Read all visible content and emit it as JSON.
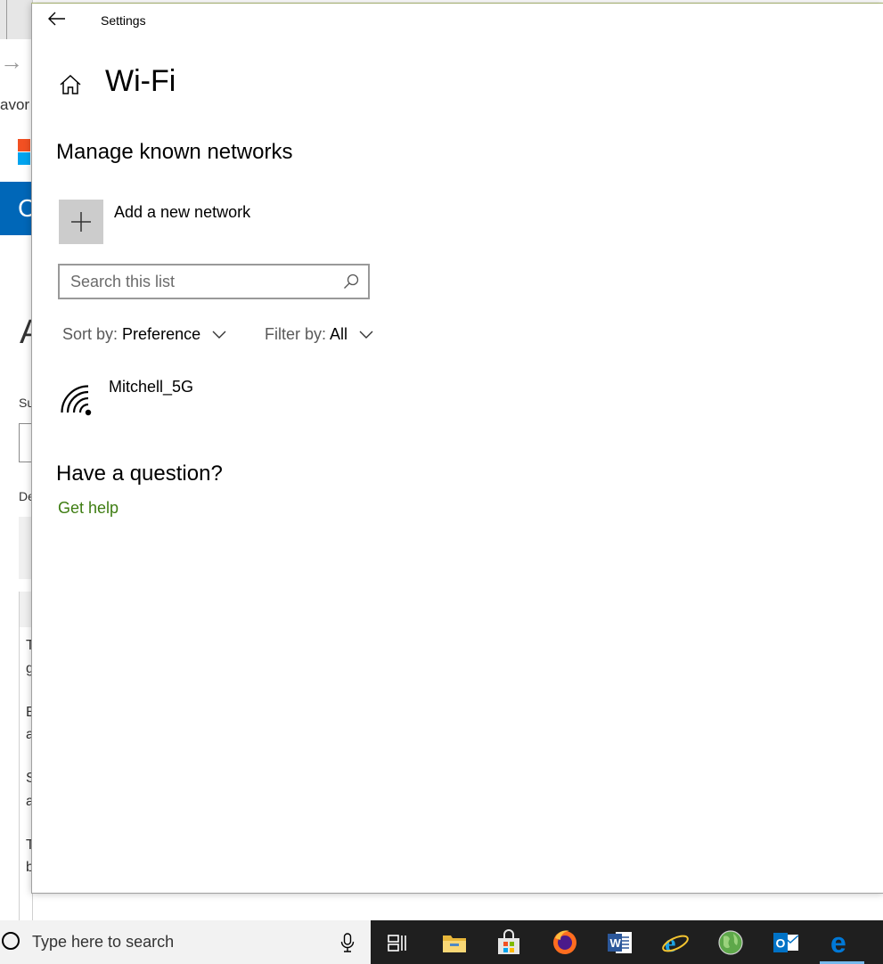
{
  "background": {
    "favorites_fragment": "avor",
    "blue_bar_fragment": "C",
    "big_letter": "A",
    "label_fragment_1": "Su",
    "label_fragment_2": "De",
    "panel_letters": [
      "T",
      "g",
      "E",
      "a",
      "S",
      "a",
      "T",
      "b"
    ]
  },
  "titlebar": {
    "title": "Settings"
  },
  "page": {
    "title": "Wi-Fi",
    "section_title": "Manage known networks",
    "add_network_label": "Add a new network",
    "search_placeholder": "Search this list",
    "sort": {
      "label": "Sort by:",
      "value": "Preference"
    },
    "filter": {
      "label": "Filter by:",
      "value": "All"
    },
    "networks": [
      {
        "name": "Mitchell_5G"
      }
    ],
    "question_title": "Have a question?",
    "help_link": "Get help"
  },
  "taskbar": {
    "search_placeholder": "Type here to search",
    "apps": [
      "task-view",
      "file-explorer",
      "microsoft-store",
      "firefox",
      "word",
      "internet-explorer",
      "globe-app",
      "outlook",
      "edge"
    ]
  },
  "colors": {
    "link_green": "#3e7d12",
    "taskbar": "#1f1f1f",
    "tile_grey": "#cccccc",
    "edge_blue": "#0078d7"
  }
}
